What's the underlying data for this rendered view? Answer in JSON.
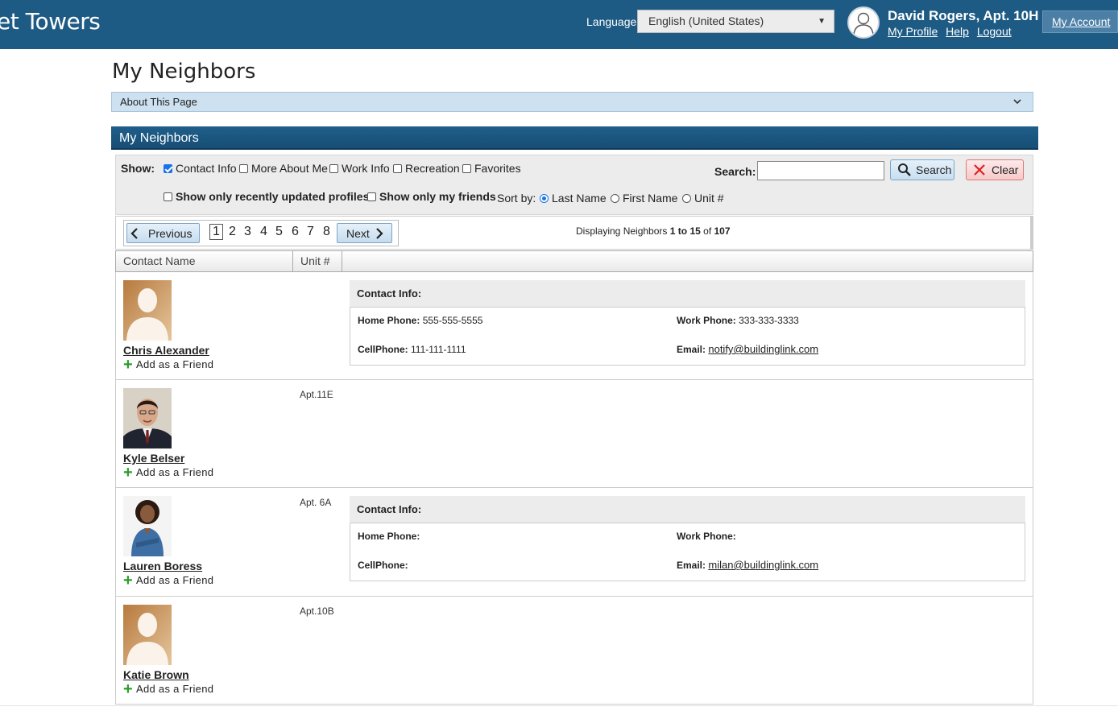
{
  "header": {
    "brand": "et Towers",
    "language_label": "Language:",
    "language_value": "English (United States)",
    "user_name": "David Rogers, Apt. 10H",
    "links": [
      "My Profile",
      "Help",
      "Logout"
    ],
    "my_account": "My Account",
    "colors": {
      "bar": "#1d5a84"
    }
  },
  "page": {
    "title": "My Neighbors",
    "about": "About This Page",
    "section_title": "My Neighbors"
  },
  "filters": {
    "show_label": "Show:",
    "show_options": [
      {
        "label": "Contact Info",
        "checked": true
      },
      {
        "label": "More About Me",
        "checked": false
      },
      {
        "label": "Work Info",
        "checked": false
      },
      {
        "label": "Recreation",
        "checked": false
      },
      {
        "label": "Favorites",
        "checked": false
      }
    ],
    "recent_label": "Show only recently updated profiles",
    "friends_label": "Show only my friends",
    "sort_label": "Sort by:",
    "sort_options": [
      {
        "label": "Last Name",
        "selected": true
      },
      {
        "label": "First Name",
        "selected": false
      },
      {
        "label": "Unit #",
        "selected": false
      }
    ],
    "search_label": "Search:",
    "search_value": "",
    "search_button": "Search",
    "clear_button": "Clear"
  },
  "pager": {
    "previous": "Previous",
    "next": "Next",
    "pages": [
      "1",
      "2",
      "3",
      "4",
      "5",
      "6",
      "7",
      "8"
    ],
    "current": "1",
    "display_prefix": "Displaying Neighbors",
    "from": "1",
    "to_word": "to",
    "to": "15",
    "of_word": "of",
    "total": "107"
  },
  "table": {
    "columns": [
      "Contact Name",
      "Unit #"
    ]
  },
  "neighbors": [
    {
      "name": "Chris Alexander",
      "unit": "",
      "add_friend": "Add as a Friend",
      "photo": "silhouette",
      "contact": {
        "title": "Contact Info:",
        "home_label": "Home Phone:",
        "home": "555-555-5555",
        "work_label": "Work Phone:",
        "work": "333-333-3333",
        "cell_label": "CellPhone:",
        "cell": "111-111-1111",
        "email_label": "Email:",
        "email": "notify@buildinglink.com"
      }
    },
    {
      "name": "Kyle Belser",
      "unit": "Apt.11E",
      "add_friend": "Add as a Friend",
      "photo": "man-suit"
    },
    {
      "name": "Lauren Boress",
      "unit": "Apt. 6A",
      "add_friend": "Add as a Friend",
      "photo": "woman",
      "contact": {
        "title": "Contact Info:",
        "home_label": "Home Phone:",
        "home": "",
        "work_label": "Work Phone:",
        "work": "",
        "cell_label": "CellPhone:",
        "cell": "",
        "email_label": "Email:",
        "email": "milan@buildinglink.com"
      }
    },
    {
      "name": "Katie Brown",
      "unit": "Apt.10B",
      "add_friend": "Add as a Friend",
      "photo": "silhouette"
    }
  ]
}
